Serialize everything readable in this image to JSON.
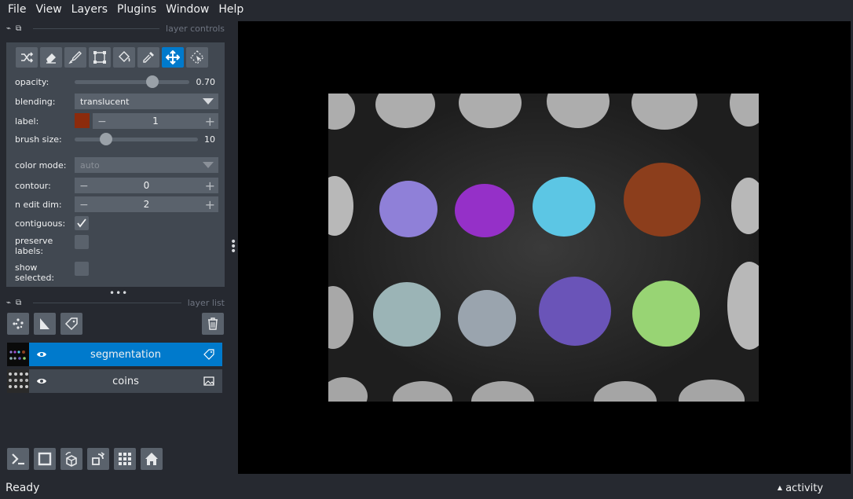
{
  "menu": [
    "File",
    "View",
    "Layers",
    "Plugins",
    "Window",
    "Help"
  ],
  "layer_controls": {
    "header": "layer controls",
    "opacity_label": "opacity:",
    "opacity_value": "0.70",
    "opacity_fraction": 0.7,
    "blending_label": "blending:",
    "blending_value": "translucent",
    "label_label": "label:",
    "label_value": "1",
    "label_color": "#8c2b0c",
    "brush_label": "brush size:",
    "brush_value": "10",
    "color_mode_label": "color mode:",
    "color_mode_value": "auto",
    "contour_label": "contour:",
    "contour_value": "0",
    "n_edit_label": "n edit dim:",
    "n_edit_value": "2",
    "contiguous_label": "contiguous:",
    "contiguous_checked": true,
    "preserve_label_1": "preserve",
    "preserve_label_2": "labels:",
    "preserve_checked": false,
    "show_label_1": "show",
    "show_label_2": "selected:",
    "show_checked": false
  },
  "layer_list": {
    "header": "layer list",
    "layers": [
      {
        "name": "segmentation",
        "selected": true,
        "type_icon": "label-tag-icon"
      },
      {
        "name": "coins",
        "selected": false,
        "type_icon": "image-icon"
      }
    ]
  },
  "status": {
    "text": "Ready",
    "activity": "activity"
  },
  "colors": {
    "accent": "#007acc",
    "bg": "#262930",
    "panel": "#414851",
    "button": "#5a626c"
  }
}
